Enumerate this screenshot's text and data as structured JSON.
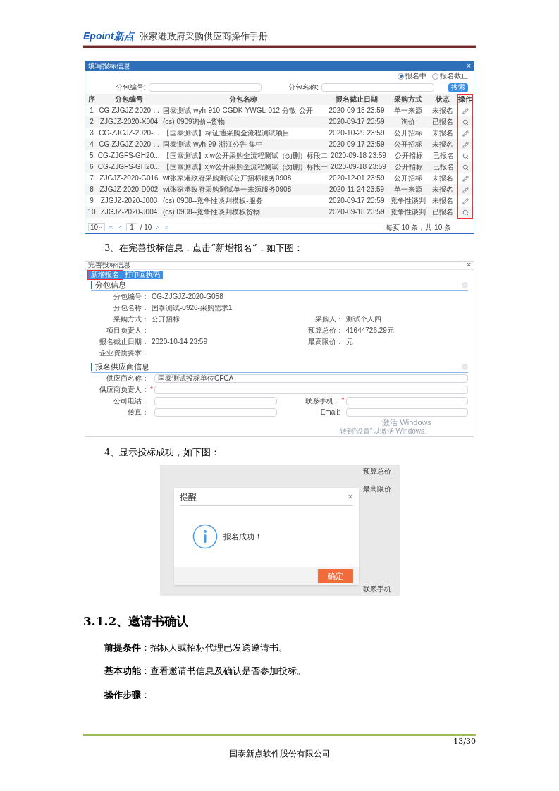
{
  "header": {
    "logo": "Epoint新点",
    "title": "张家港政府采购供应商操作手册"
  },
  "figure_1": {
    "window_title": "填写报标信息",
    "window_close": "×",
    "filters": [
      {
        "label": "报名中",
        "selected": true
      },
      {
        "label": "报名截止",
        "selected": false
      }
    ],
    "search": [
      {
        "label": "分包编号:"
      },
      {
        "label": "分包名称:"
      }
    ],
    "search_button": "搜索",
    "columns": [
      "序",
      "分包编号",
      "分包名称",
      "报名截止日期",
      "采购方式",
      "状态",
      "操作"
    ],
    "rows": [
      {
        "cells": [
          "1",
          "CG-ZJGJZ-2020-...",
          "国泰测试-wyh-910-CGDK-YWGL-012-分散-公开",
          "2020-09-18 23:59",
          "单一来源",
          "未报名"
        ],
        "kind": "edit"
      },
      {
        "cells": [
          "2",
          "ZJGJZ-2020-X004",
          "(cs) 0909询价--货物",
          "2020-09-17 23:59",
          "询价",
          "已报名"
        ],
        "kind": "view"
      },
      {
        "cells": [
          "3",
          "CG-ZJGJZ-2020-...",
          "【国泰测试】标证通采购全流程测试项目",
          "2020-10-29 23:59",
          "公开招标",
          "未报名"
        ],
        "kind": "edit"
      },
      {
        "cells": [
          "4",
          "CG-ZJGJZ-2020-...",
          "国泰测试-wyh-99-浙江公告-集中",
          "2020-09-17 23:59",
          "公开招标",
          "未报名"
        ],
        "kind": "edit"
      },
      {
        "cells": [
          "5",
          "CG-ZJGFS-GH20...",
          "【国泰测试】xjw公开采购全流程测试（勿删）标段二",
          "2020-09-18 23:59",
          "公开招标",
          "已报名"
        ],
        "kind": "view"
      },
      {
        "cells": [
          "6",
          "CG-ZJGFS-GH20...",
          "【国泰测试】xjw公开采购全流程测试（勿删）标段一",
          "2020-09-18 23:59",
          "公开招标",
          "已报名"
        ],
        "kind": "view"
      },
      {
        "cells": [
          "7",
          "ZJGJZ-2020-G016",
          "wt张家港政府采购测试公开招标服务0908",
          "2020-12-01 23:59",
          "公开招标",
          "未报名"
        ],
        "kind": "edit"
      },
      {
        "cells": [
          "8",
          "ZJGJZ-2020-D002",
          "wt张家港政府采购测试单一来源服务0908",
          "2020-11-24 23:59",
          "单一来源",
          "未报名"
        ],
        "kind": "edit"
      },
      {
        "cells": [
          "9",
          "ZJGJZ-2020-J003",
          "(cs) 0908--竞争性谈判模板-服务",
          "2020-09-17 23:59",
          "竞争性谈判",
          "未报名"
        ],
        "kind": "edit"
      },
      {
        "cells": [
          "10",
          "ZJGJZ-2020-J004",
          "(cs) 0908--竞争性谈判模板货物",
          "2020-09-18 23:59",
          "竞争性谈判",
          "已报名"
        ],
        "kind": "view"
      }
    ],
    "pager": {
      "page_size": "10",
      "page": "1",
      "pages": "/ 10",
      "summary": "每页 10 条，共 10 条"
    }
  },
  "caption_3": "3、在完善投标信息，点击“新增报名”，如下图：",
  "figure_2": {
    "window_title": "完善投标信息",
    "window_close": "×",
    "buttons": [
      {
        "label": "新增报名",
        "highlighted": true
      },
      {
        "label": "打印回执码",
        "highlighted": false
      }
    ],
    "package_title": "分包信息",
    "package_rows": [
      [
        {
          "label": "分包编号：",
          "value": "CG-ZJGJZ-2020-G058"
        }
      ],
      [
        {
          "label": "分包名称：",
          "value": "国泰测试-0926-采购需求1"
        }
      ],
      [
        {
          "label": "采购方式：",
          "value": "公开招标"
        },
        {
          "label": "采购人：",
          "value": "测试个人四"
        }
      ],
      [
        {
          "label": "项目负责人："
        },
        {
          "label": "预算总价：",
          "value": "41644726.29元"
        }
      ],
      [
        {
          "label": "报名截止日期：",
          "value": "2020-10-14 23:59"
        },
        {
          "label": "最高限价：",
          "value": "元"
        }
      ],
      [
        {
          "label": "企业资质要求："
        }
      ]
    ],
    "supplier_title": "报名供应商信息",
    "supplier_rows": [
      [
        {
          "label": "供应商名称：",
          "value": "国泰测试投标单位CFCA"
        }
      ],
      [
        {
          "label": "供应商负责人：",
          "required_mark": "*"
        }
      ],
      [
        {
          "label": "公司电话："
        },
        {
          "label": "联系手机：",
          "required_mark": "*"
        }
      ],
      [
        {
          "label": "传真："
        },
        {
          "label": "Email:"
        }
      ]
    ],
    "activation": {
      "title": "激活 Windows",
      "hint": "转到\"设置\"以激活 Windows。"
    }
  },
  "caption_4": "4、显示投标成功，如下图：",
  "figure_3": {
    "background_labels": [
      "预算总价",
      "最高限价",
      "联系手机"
    ],
    "dialog": {
      "title": "提醒",
      "close": "×",
      "message": "报名成功！",
      "button": "确定"
    }
  },
  "section": {
    "heading": "3.1.2、邀请书确认",
    "paragraphs": [
      "**前提条件**：招标人或招标代理已发送邀请书。",
      "**基本功能**：查看邀请书信息及确认是否参加投标。",
      "**操作步骤**："
    ]
  },
  "footer": {
    "page": "13/30",
    "company": "国泰新点软件股份有限公司"
  }
}
